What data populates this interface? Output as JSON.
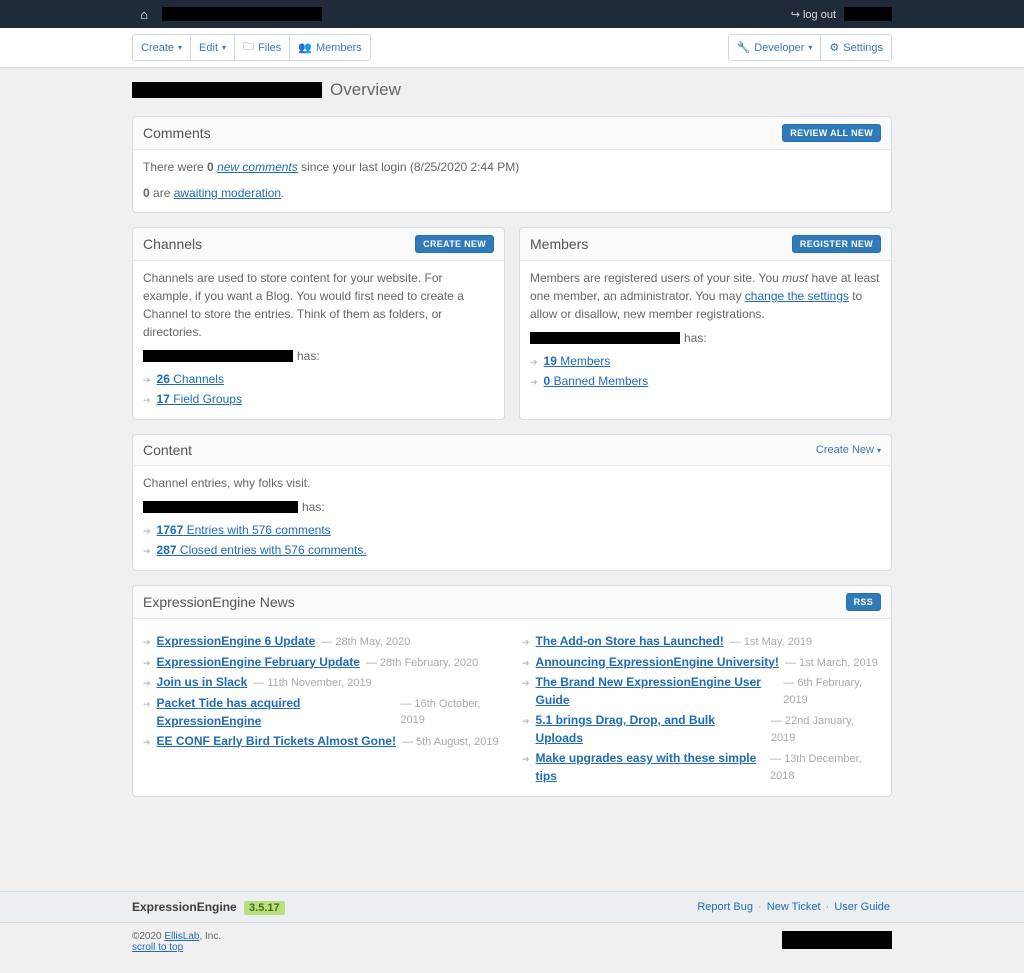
{
  "topbar": {
    "logout": "log out"
  },
  "toolbar": {
    "create": "Create",
    "edit": "Edit",
    "files": "Files",
    "members": "Members",
    "developer": "Developer",
    "settings": "Settings"
  },
  "page": {
    "title_suffix": "Overview"
  },
  "comments": {
    "heading": "Comments",
    "review_btn": "REVIEW ALL NEW",
    "line1a": "There were ",
    "count_new": "0",
    "line1b": "new comments",
    "line1c": " since your last login (8/25/2020 2:44 PM)",
    "line2a": "0",
    "line2b": " are ",
    "line2c": "awaiting moderation",
    "line2d": "."
  },
  "channels": {
    "heading": "Channels",
    "create_btn": "CREATE NEW",
    "desc": "Channels are used to store content for your website. For example, if you want a Blog. You would first need to create a Channel to store the entries. Think of them as folders, or directories.",
    "has": " has:",
    "items": [
      {
        "num": "26",
        "label": "Channels"
      },
      {
        "num": "17",
        "label": "Field Groups"
      }
    ]
  },
  "members": {
    "heading": "Members",
    "register_btn": "REGISTER NEW",
    "desc_a": "Members are registered users of your site. You ",
    "desc_em": "must",
    "desc_b": " have at least one member, an administrator. You may ",
    "desc_link": "change the settings",
    "desc_c": " to allow or disallow, new member registrations.",
    "has": " has:",
    "items": [
      {
        "num": "19",
        "label": "Members"
      },
      {
        "num": "0",
        "label": "Banned Members"
      }
    ]
  },
  "content": {
    "heading": "Content",
    "create_btn": "Create New",
    "desc": "Channel entries, why folks visit.",
    "has": " has:",
    "items": [
      {
        "num": "1767",
        "label": "Entries with 576 comments"
      },
      {
        "num": "287",
        "label": "Closed entries with 576 comments."
      }
    ]
  },
  "news": {
    "heading": "ExpressionEngine News",
    "rss": "RSS",
    "left": [
      {
        "title": "ExpressionEngine 6 Update",
        "date": "28th May, 2020"
      },
      {
        "title": "ExpressionEngine February Update",
        "date": "28th February, 2020"
      },
      {
        "title": "Join us in Slack",
        "date": "11th November, 2019"
      },
      {
        "title": "Packet Tide has acquired ExpressionEngine",
        "date": "16th October, 2019"
      },
      {
        "title": "EE CONF Early Bird Tickets Almost Gone!",
        "date": "5th August, 2019"
      }
    ],
    "right": [
      {
        "title": "The Add-on Store has Launched!",
        "date": "1st May, 2019"
      },
      {
        "title": "Announcing ExpressionEngine University!",
        "date": "1st March, 2019"
      },
      {
        "title": "The Brand New ExpressionEngine User Guide",
        "date": "6th February, 2019"
      },
      {
        "title": "5.1 brings Drag, Drop, and Bulk Uploads",
        "date": "22nd January, 2019"
      },
      {
        "title": "Make upgrades easy with these simple tips",
        "date": "13th December, 2018"
      }
    ]
  },
  "footer": {
    "brand": "ExpressionEngine",
    "version": "3.5.17",
    "report_bug": "Report Bug",
    "new_ticket": "New Ticket",
    "user_guide": "User Guide",
    "copyright_a": "©2020 ",
    "copyright_link": "EllisLab",
    "copyright_b": ", Inc.",
    "scroll": "scroll to top"
  }
}
